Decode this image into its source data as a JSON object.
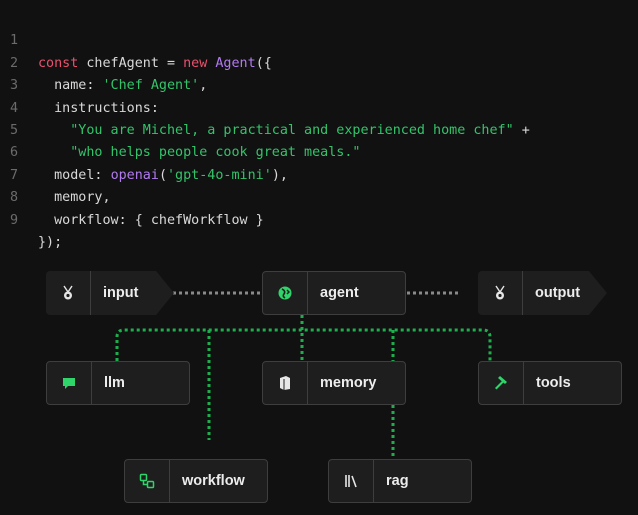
{
  "code": {
    "line_numbers": [
      "1",
      "2",
      "3",
      "4",
      "5",
      "6",
      "7",
      "8",
      "9"
    ],
    "l1": {
      "const": "const",
      "name": " chefAgent = ",
      "new": "new",
      "cls": " Agent",
      "rest": "({"
    },
    "l2": {
      "key": "  name: ",
      "val": "'Chef Agent'",
      "rest": ","
    },
    "l3": {
      "key": "  instructions:"
    },
    "l4": {
      "val": "    \"You are Michel, a practical and experienced home chef\"",
      "rest": " +"
    },
    "l5": {
      "val": "    \"who helps people cook great meals.\""
    },
    "l6": {
      "key": "  model: ",
      "fn": "openai",
      "open": "(",
      "val": "'gpt-4o-mini'",
      "rest": "),"
    },
    "l7": {
      "key": "  memory,"
    },
    "l8": {
      "key": "  workflow: { chefWorkflow }"
    },
    "l9": {
      "key": "});"
    }
  },
  "diagram": {
    "nodes": {
      "input": {
        "label": "input",
        "icon": "medal-icon"
      },
      "agent": {
        "label": "agent",
        "icon": "globe-icon",
        "accent": "#2fd46b"
      },
      "output": {
        "label": "output",
        "icon": "medal-icon"
      },
      "llm": {
        "label": "llm",
        "icon": "chat-icon",
        "accent": "#2fd46b"
      },
      "memory": {
        "label": "memory",
        "icon": "book-icon"
      },
      "tools": {
        "label": "tools",
        "icon": "hammer-icon",
        "accent": "#2fd46b"
      },
      "workflow": {
        "label": "workflow",
        "icon": "workflow-icon",
        "accent": "#2fd46b"
      },
      "rag": {
        "label": "rag",
        "icon": "library-icon"
      }
    },
    "colors": {
      "background": "#111111",
      "node_bg": "#1e1e1e",
      "node_border": "#3e3e3e",
      "gray_link": "#8a8a8a",
      "green_link": "#1fae4e"
    }
  }
}
